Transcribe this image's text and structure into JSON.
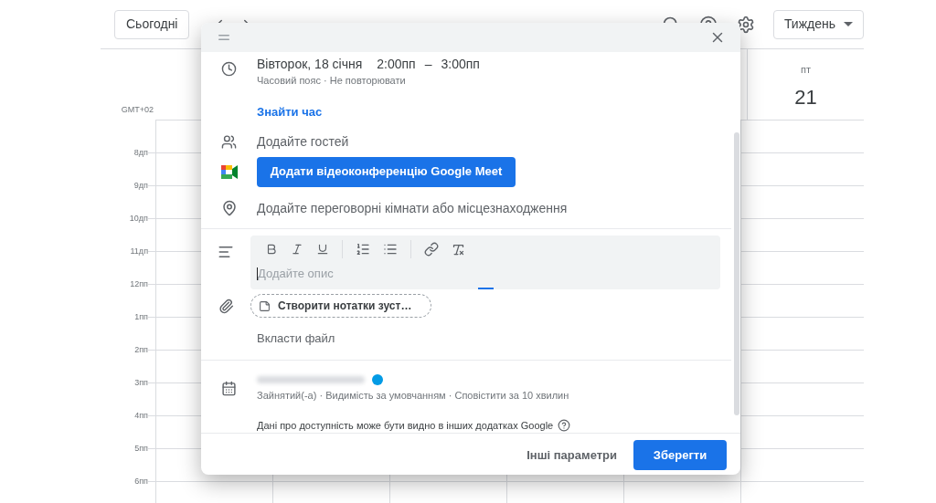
{
  "toolbar": {
    "today_button": "Сьогодні",
    "view_select": "Тиждень"
  },
  "day_header": {
    "weekday": "пт",
    "day": "21"
  },
  "timezone_label": "GMT+02",
  "hours": [
    "8дп",
    "9дп",
    "10дп",
    "11дп",
    "12пп",
    "1пп",
    "2пп",
    "3пп",
    "4пп",
    "5пп",
    "6пп"
  ],
  "dialog": {
    "date": "Вівторок, 18 січня",
    "start_time": "2:00пп",
    "dash": "–",
    "end_time": "3:00пп",
    "time_options": "Часовий пояс · Не повторювати",
    "find_time_link": "Знайти час",
    "guests_placeholder": "Додайте гостей",
    "meet_button": "Додати відеоконференцію Google Meet",
    "location_placeholder": "Додайте переговорні кімнати або місцезнаходження",
    "description_placeholder": "Додайте опис",
    "notes_chip": "Створити нотатки зуст…",
    "attach_link": "Вкласти файл",
    "calendar": {
      "color": "#039be5",
      "details": "Зайнятий(-а) · Видимість за умовчанням · Сповістити за 10 хвилин"
    },
    "availability_note": "Дані про доступність може бути видно в інших додатках Google",
    "more_options_button": "Інші параметри",
    "save_button": "Зберегти"
  }
}
